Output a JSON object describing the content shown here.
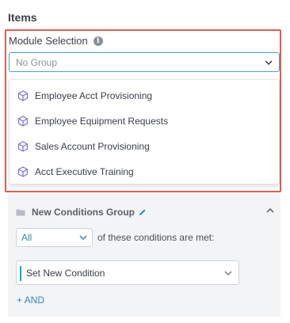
{
  "section": {
    "title": "Items"
  },
  "module_selection": {
    "label": "Module Selection",
    "info_icon": "info-icon",
    "selected_value": "No Group",
    "options": [
      {
        "label": "Employee Acct Provisioning",
        "icon": "cube-icon"
      },
      {
        "label": "Employee Equipment Requests",
        "icon": "cube-icon"
      },
      {
        "label": "Sales Account Provisioning",
        "icon": "cube-icon"
      },
      {
        "label": "Acct Executive Training",
        "icon": "cube-icon"
      }
    ]
  },
  "conditions_group": {
    "title": "New Conditions Group",
    "match_select_value": "All",
    "match_text": "of these conditions are met:",
    "condition_placeholder": "Set New Condition",
    "add_and_label": "+ AND"
  },
  "colors": {
    "highlight_border": "#e35d4e",
    "accent": "#2c8fb0",
    "select_focus_border": "#4aa3b8",
    "cube_icon": "#7b6fd6"
  }
}
